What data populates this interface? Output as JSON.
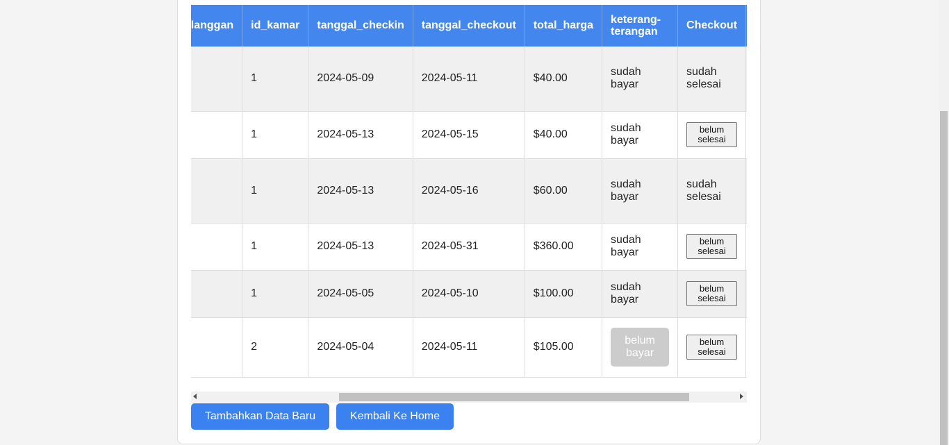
{
  "table": {
    "headers": [
      "id_pelanggan",
      "id_kamar",
      "tanggal_checkin",
      "tanggal_checkout",
      "total_harga",
      "keterang-terangan",
      "Checkout",
      ""
    ],
    "rows": [
      {
        "id_pelanggan": "",
        "id_kamar": "1",
        "checkin": "2024-05-09",
        "checkout": "2024-05-11",
        "total": "$40.00",
        "keterangan": "sudah bayar",
        "keterangan_button": false,
        "checkout_status": "sudah selesai",
        "checkout_button": false
      },
      {
        "id_pelanggan": "",
        "id_kamar": "1",
        "checkin": "2024-05-13",
        "checkout": "2024-05-15",
        "total": "$40.00",
        "keterangan": "sudah bayar",
        "keterangan_button": false,
        "checkout_status": "belum selesai",
        "checkout_button": true
      },
      {
        "id_pelanggan": "",
        "id_kamar": "1",
        "checkin": "2024-05-13",
        "checkout": "2024-05-16",
        "total": "$60.00",
        "keterangan": "sudah bayar",
        "keterangan_button": false,
        "checkout_status": "sudah selesai",
        "checkout_button": false
      },
      {
        "id_pelanggan": "",
        "id_kamar": "1",
        "checkin": "2024-05-13",
        "checkout": "2024-05-31",
        "total": "$360.00",
        "keterangan": "sudah bayar",
        "keterangan_button": false,
        "checkout_status": "belum selesai",
        "checkout_button": true
      },
      {
        "id_pelanggan": "",
        "id_kamar": "1",
        "checkin": "2024-05-05",
        "checkout": "2024-05-10",
        "total": "$100.00",
        "keterangan": "sudah bayar",
        "keterangan_button": false,
        "checkout_status": "belum selesai",
        "checkout_button": true
      },
      {
        "id_pelanggan": "",
        "id_kamar": "2",
        "checkin": "2024-05-04",
        "checkout": "2024-05-11",
        "total": "$105.00",
        "keterangan": "belum bayar",
        "keterangan_button": true,
        "checkout_status": "belum selesai",
        "checkout_button": true
      }
    ]
  },
  "actions": {
    "add_label": "Tambahkan Data Baru",
    "home_label": "Kembali Ke Home"
  },
  "colors": {
    "header_bg": "#4387ee",
    "primary_button": "#3b82f0",
    "disabled_button": "#cccccc"
  },
  "icons": {
    "scroll_left": "chevron-left-icon",
    "scroll_right": "chevron-right-icon"
  }
}
